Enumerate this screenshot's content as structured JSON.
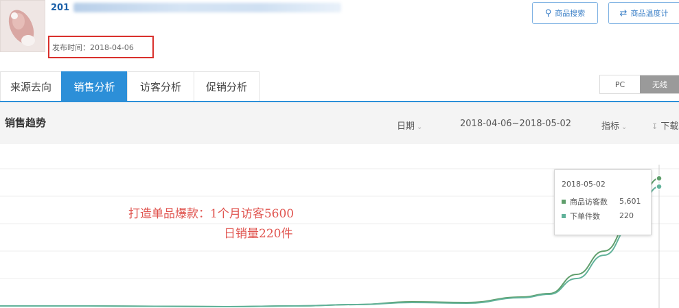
{
  "product": {
    "title_prefix": "201",
    "publish_label": "发布时间：2018-04-06"
  },
  "top_buttons": {
    "search_label": "商品搜索",
    "track_label": "商品温度计"
  },
  "tabs": [
    {
      "label": "来源去向"
    },
    {
      "label": "销售分析",
      "active": true
    },
    {
      "label": "访客分析"
    },
    {
      "label": "促销分析"
    }
  ],
  "device_toggle": {
    "pc_label": "PC",
    "wireless_label": "无线",
    "selected": "无线"
  },
  "panel": {
    "title": "销售趋势",
    "date_label": "日期",
    "date_range": "2018-04-06~2018-05-02",
    "metric_label": "指标",
    "download_label": "下载"
  },
  "annotation": {
    "line1": "打造单品爆款：1个月访客5600",
    "line2": "日销量220件"
  },
  "tooltip": {
    "date": "2018-05-02",
    "rows": [
      {
        "name": "商品访客数",
        "value": "5,601",
        "color": "#5f9e6b"
      },
      {
        "name": "下单件数",
        "value": "220",
        "color": "#61b29a"
      }
    ]
  },
  "chart_data": {
    "type": "line",
    "x_start": "2018-04-06",
    "x_end": "2018-05-02",
    "series": [
      {
        "name": "商品访客数",
        "color": "#5f9e6b",
        "values": [
          0,
          0,
          0,
          0,
          0,
          0,
          0,
          0,
          0,
          0,
          0,
          0,
          0,
          0,
          0,
          0,
          0,
          0,
          0,
          0,
          0,
          0,
          0,
          0,
          0,
          0,
          5601
        ]
      },
      {
        "name": "下单件数",
        "color": "#61b29a",
        "values": [
          0,
          0,
          0,
          0,
          0,
          0,
          0,
          0,
          0,
          0,
          0,
          0,
          0,
          0,
          0,
          0,
          0,
          0,
          0,
          0,
          0,
          0,
          0,
          0,
          0,
          0,
          220
        ]
      }
    ]
  }
}
